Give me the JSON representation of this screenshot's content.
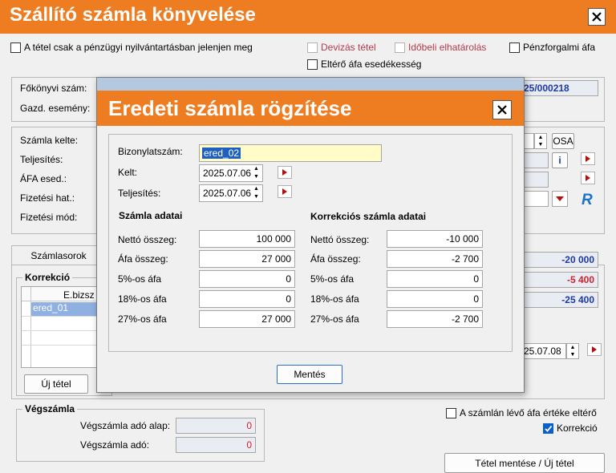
{
  "window": {
    "title": "Szállító számla könyvelése"
  },
  "top_options": {
    "only_financial": "A tétel csak a pénzügyi nyilvántartásban jelenjen meg",
    "foreign_currency": "Devizás tétel",
    "deferral": "Időbeli elhatárolás",
    "cash_vat": "Pénzforgalmi áfa",
    "different_vat_due": "Eltérő áfa esedékesség"
  },
  "main_form": {
    "ledger_number_label": "Főkönyvi szám:",
    "ledger_number_value": "25/000218",
    "economic_event_label": "Gazd. esemény:",
    "invoice_date_label": "Számla kelte:",
    "fulfillment_label": "Teljesítés:",
    "vat_due_label": "ÁFA esed.:",
    "payment_due_label": "Fizetési hat.:",
    "payment_method_label": "Fizetési mód:",
    "osa_label": "OSA",
    "info_label": "i",
    "lines_tab": "Számlasorok",
    "summary_values": [
      "-20 000",
      "-5 400",
      "-25 400"
    ],
    "date_value": "25.07.08"
  },
  "correction_group": {
    "label": "Korrekció",
    "column_header": "E.bizsz",
    "rows": [
      "ered_01"
    ],
    "new_item_button": "Új tétel"
  },
  "final_invoice": {
    "label": "Végszámla",
    "tax_base_label": "Végszámla adó alap:",
    "tax_base_value": "0",
    "tax_label": "Végszámla adó:",
    "tax_value": "0"
  },
  "right_options": {
    "vat_differs": "A számlán lévő áfa értéke eltérő",
    "correction": "Korrekció"
  },
  "save_new_button": "Tétel mentése / Új tétel",
  "modal": {
    "title": "Eredeti számla rögzítése",
    "doc_number_label": "Bizonylatszám:",
    "doc_number_value": "ered_02",
    "date_label": "Kelt:",
    "date_value": "2025.07.06",
    "fulfillment_label": "Teljesítés:",
    "fulfillment_value": "2025.07.06",
    "invoice_section": "Számla adatai",
    "correction_section": "Korrekciós számla adatai",
    "invoice_rows": [
      {
        "label": "Nettó összeg:",
        "value": "100 000"
      },
      {
        "label": "Áfa összeg:",
        "value": "27 000"
      },
      {
        "label": "5%-os áfa",
        "value": "0"
      },
      {
        "label": "18%-os áfa",
        "value": "0"
      },
      {
        "label": "27%-os áfa",
        "value": "27 000"
      }
    ],
    "correction_rows": [
      {
        "label": "Nettó összeg:",
        "value": "-10 000"
      },
      {
        "label": "Áfa összeg:",
        "value": "-2 700"
      },
      {
        "label": "5%-os áfa",
        "value": "0"
      },
      {
        "label": "18%-os áfa",
        "value": "0"
      },
      {
        "label": "27%-os áfa",
        "value": "-2 700"
      }
    ],
    "save_button": "Mentés"
  },
  "colors": {
    "accent": "#ee7d22",
    "selection": "#1f5fbf",
    "negative": "#d0222b",
    "summary": "#1b3aa6"
  }
}
